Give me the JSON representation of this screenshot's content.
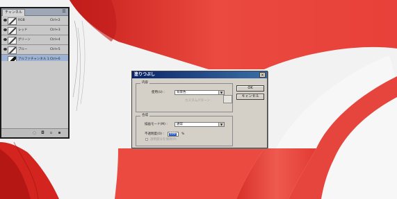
{
  "channels_panel": {
    "tab_label": "チャンネル",
    "menu_icon": "panel-menu-icon",
    "channels": [
      {
        "name": "RGB",
        "shortcut": "Ctrl+2",
        "selected": false
      },
      {
        "name": "レッド",
        "shortcut": "Ctrl+3",
        "selected": false
      },
      {
        "name": "グリーン",
        "shortcut": "Ctrl+4",
        "selected": false
      },
      {
        "name": "ブルー",
        "shortcut": "Ctrl+5",
        "selected": false
      },
      {
        "name": "アルファチャンネル 1",
        "shortcut": "Ctrl+6",
        "selected": true
      }
    ],
    "footer_icons": [
      "load-selection-icon",
      "save-selection-icon",
      "new-channel-icon",
      "delete-channel-icon"
    ]
  },
  "fill_dialog": {
    "title": "塗りつぶし",
    "close_glyph": "×",
    "contents": {
      "group_label": "内容",
      "use_label": "使用(U) :",
      "use_value": "背景色",
      "custom_pattern_label": "カスタムパターン :"
    },
    "blending": {
      "group_label": "合成",
      "mode_label": "描画モード(M) :",
      "mode_value": "通常",
      "opacity_label": "不透明度(O) :",
      "opacity_value": "100",
      "opacity_unit": "%",
      "preserve_label": "透明部分を保持(P)"
    },
    "ok_label": "OK",
    "cancel_label": "キャンセル"
  },
  "colors": {
    "canvas_red": "#e23a33",
    "title_bar": "#0a246a",
    "panel_selected": "#9db3d6"
  }
}
